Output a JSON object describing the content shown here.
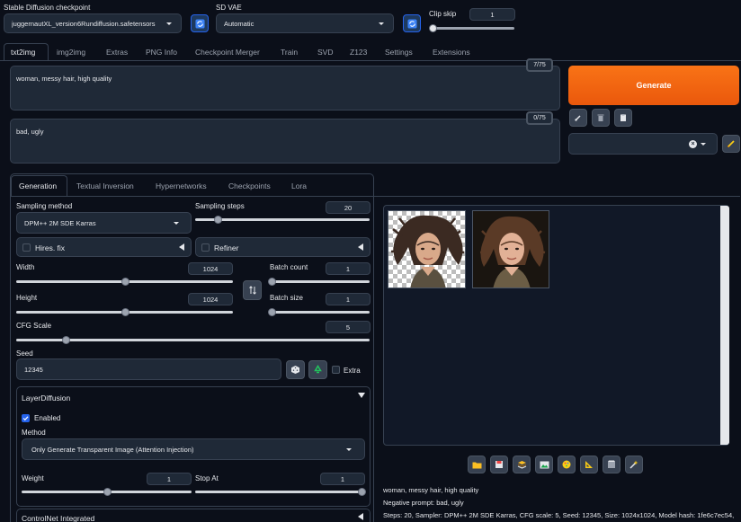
{
  "header": {
    "checkpoint_label": "Stable Diffusion checkpoint",
    "checkpoint_value": "juggernautXL_version6Rundiffusion.safetensors",
    "vae_label": "SD VAE",
    "vae_value": "Automatic",
    "clip_skip_label": "Clip skip",
    "clip_skip_value": "1"
  },
  "tabs": [
    "txt2img",
    "img2img",
    "Extras",
    "PNG Info",
    "Checkpoint Merger",
    "Train",
    "SVD",
    "Z123",
    "Settings",
    "Extensions"
  ],
  "prompt": {
    "positive": "woman, messy hair, high quality",
    "positive_count": "7/75",
    "negative": "bad, ugly",
    "negative_count": "0/75"
  },
  "generate_label": "Generate",
  "subtabs": [
    "Generation",
    "Textual Inversion",
    "Hypernetworks",
    "Checkpoints",
    "Lora"
  ],
  "generation": {
    "sampling_method_label": "Sampling method",
    "sampling_method_value": "DPM++ 2M SDE Karras",
    "sampling_steps_label": "Sampling steps",
    "sampling_steps_value": "20",
    "sampling_steps_fraction": 0.13,
    "hires_label": "Hires. fix",
    "refiner_label": "Refiner",
    "width_label": "Width",
    "width_value": "1024",
    "width_fraction": 0.5,
    "height_label": "Height",
    "height_value": "1024",
    "height_fraction": 0.5,
    "batch_count_label": "Batch count",
    "batch_count_value": "1",
    "batch_count_fraction": 0.0,
    "batch_size_label": "Batch size",
    "batch_size_value": "1",
    "batch_size_fraction": 0.0,
    "cfg_label": "CFG Scale",
    "cfg_value": "5",
    "cfg_fraction": 0.14,
    "seed_label": "Seed",
    "seed_value": "12345",
    "extra_label": "Extra"
  },
  "layer_diffusion": {
    "title": "LayerDiffusion",
    "enabled_label": "Enabled",
    "method_label": "Method",
    "method_value": "Only Generate Transparent Image (Attention Injection)",
    "weight_label": "Weight",
    "weight_value": "1",
    "weight_fraction": 0.5,
    "stop_at_label": "Stop At",
    "stop_at_value": "1",
    "stop_at_fraction": 1.0
  },
  "controlnet_title": "ControlNet Integrated",
  "output": {
    "prompt_line": "woman, messy hair, high quality",
    "negative_line": "Negative prompt: bad, ugly",
    "params_line": "Steps: 20, Sampler: DPM++ 2M SDE Karras, CFG scale: 5, Seed: 12345, Size: 1024x1024, Model hash: 1fe6c7ec54,"
  },
  "icons": {
    "refresh": "refresh-icon",
    "swap": "swap-dimensions-icon",
    "dice": "dice-icon",
    "recycle": "recycle-icon",
    "folder": "folder-icon",
    "save": "save-icon",
    "zip": "zip-icon",
    "image": "send-to-img2img-icon",
    "palette": "send-to-inpaint-icon",
    "ruler": "send-to-extras-icon",
    "film": "send-to-svd-icon",
    "sparkle": "upscale-icon",
    "brush": "brush-icon",
    "trash": "trash-icon",
    "clipboard": "clipboard-icon",
    "pencil": "edit-icon"
  },
  "colors": {
    "generate": "#ea580c",
    "accent_blue": "#2563eb",
    "background": "#0b0f19"
  }
}
